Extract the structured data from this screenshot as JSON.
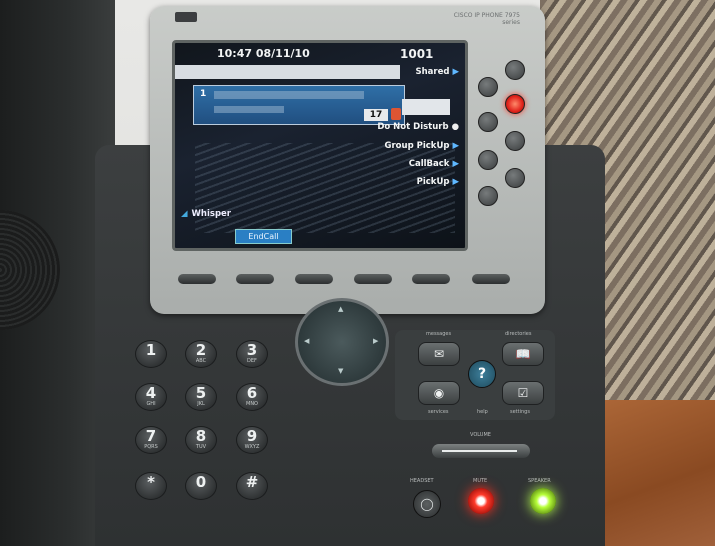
{
  "phone": {
    "model_text": "CISCO IP PHONE 7975 series",
    "screen": {
      "time_date": "10:47 08/11/10",
      "line_number": "1001",
      "call": {
        "index": "1",
        "duration": "17"
      },
      "line_keys": [
        "Shared",
        "",
        "Do Not Disturb",
        "Group PickUp",
        "CallBack",
        "PickUp"
      ],
      "status": "Whisper",
      "softkey": "EndCall"
    },
    "keypad": [
      {
        "digit": "1",
        "letters": ""
      },
      {
        "digit": "2",
        "letters": "ABC"
      },
      {
        "digit": "3",
        "letters": "DEF"
      },
      {
        "digit": "4",
        "letters": "GHI"
      },
      {
        "digit": "5",
        "letters": "JKL"
      },
      {
        "digit": "6",
        "letters": "MNO"
      },
      {
        "digit": "7",
        "letters": "PQRS"
      },
      {
        "digit": "8",
        "letters": "TUV"
      },
      {
        "digit": "9",
        "letters": "WXYZ"
      },
      {
        "digit": "*",
        "letters": ""
      },
      {
        "digit": "0",
        "letters": ""
      },
      {
        "digit": "#",
        "letters": ""
      }
    ],
    "function_labels": {
      "messages": "messages",
      "directories": "directories",
      "services": "services",
      "help": "help",
      "settings": "settings",
      "volume": "VOLUME",
      "headset": "HEADSET",
      "mute": "MUTE",
      "speaker": "SPEAKER"
    },
    "icons": {
      "messages": "envelope-icon",
      "directories": "book-icon",
      "services": "globe-icon",
      "settings": "checklist-icon",
      "help": "question-icon",
      "headset": "headset-icon"
    },
    "colors": {
      "mute_led": "#ff3a2a",
      "speaker_led": "#b8ff3a",
      "line_led": "#e0201a",
      "screen_accent": "#2a7fc4"
    }
  }
}
